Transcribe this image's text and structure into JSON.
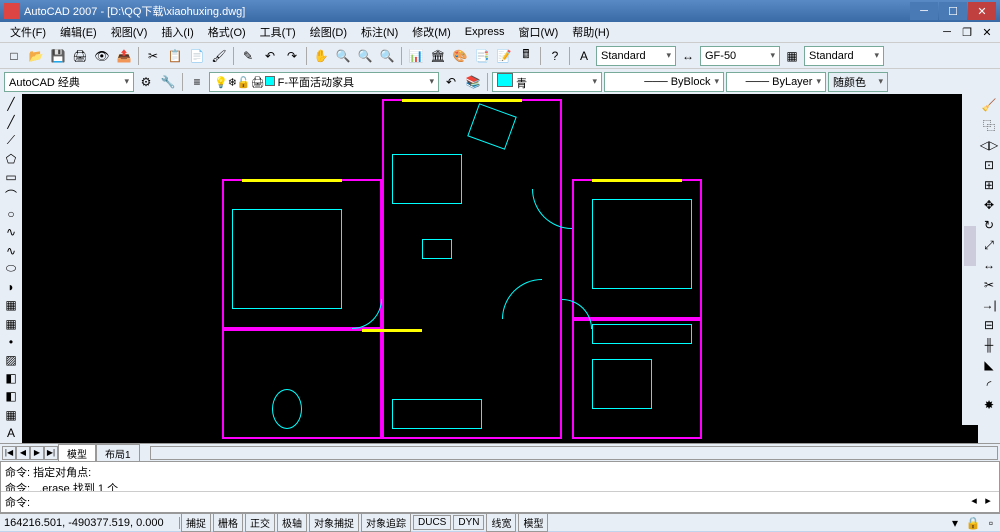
{
  "titlebar": {
    "app": "AutoCAD 2007",
    "doc": "[D:\\QQ下载\\xiaohuxing.dwg]"
  },
  "menu": [
    "文件(F)",
    "编辑(E)",
    "视图(V)",
    "插入(I)",
    "格式(O)",
    "工具(T)",
    "绘图(D)",
    "标注(N)",
    "修改(M)",
    "Express",
    "窗口(W)",
    "帮助(H)"
  ],
  "toolbar2": {
    "workspace": "AutoCAD 经典",
    "layer": "F-平面活动家具",
    "textstyle": "Standard",
    "dimstyle": "GF-50",
    "tablestyle": "Standard"
  },
  "props": {
    "color": "青",
    "linetype": "ByBlock",
    "lineweight": "ByLayer",
    "plotstyle": "随颜色"
  },
  "tabs": {
    "model": "模型",
    "layout1": "布局1"
  },
  "cmd": {
    "line1": "命令: 指定对角点:",
    "line2": "命令: _.erase 找到 1 个",
    "prompt": "命令:"
  },
  "status": {
    "coords": "164216.501, -490377.519, 0.000",
    "buttons": [
      "捕捉",
      "栅格",
      "正交",
      "极轴",
      "对象捕捉",
      "对象追踪",
      "DUCS",
      "DYN",
      "线宽",
      "模型"
    ]
  },
  "icons": {
    "new": "□",
    "open": "📂",
    "save": "💾",
    "plot": "🖨",
    "cut": "✂",
    "copy": "📋",
    "paste": "📄",
    "undo": "↶",
    "redo": "↷",
    "pan": "✋",
    "zoom": "🔍",
    "line": "╱",
    "cline": "╱",
    "pline": "⟋",
    "poly": "⬠",
    "rect": "▭",
    "arc": "⌒",
    "circle": "○",
    "spline": "∿",
    "ellipse": "⬭",
    "earc": "◗",
    "block": "▦",
    "point": "•",
    "hatch": "▨",
    "region": "◧",
    "table": "▦",
    "text": "A",
    "dist": "📏",
    "area": "▱",
    "m3": "🔧",
    "m4": "⊡",
    "m5": "↻",
    "m6": "✂",
    "m7": "✂",
    "m8": "⟳",
    "m9": "↔",
    "m10": "□",
    "m11": "⊞",
    "m12": "⊟",
    "m13": "╫",
    "m14": "✕",
    "m15": "⊡",
    "m16": "✎",
    "m17": "▦"
  }
}
